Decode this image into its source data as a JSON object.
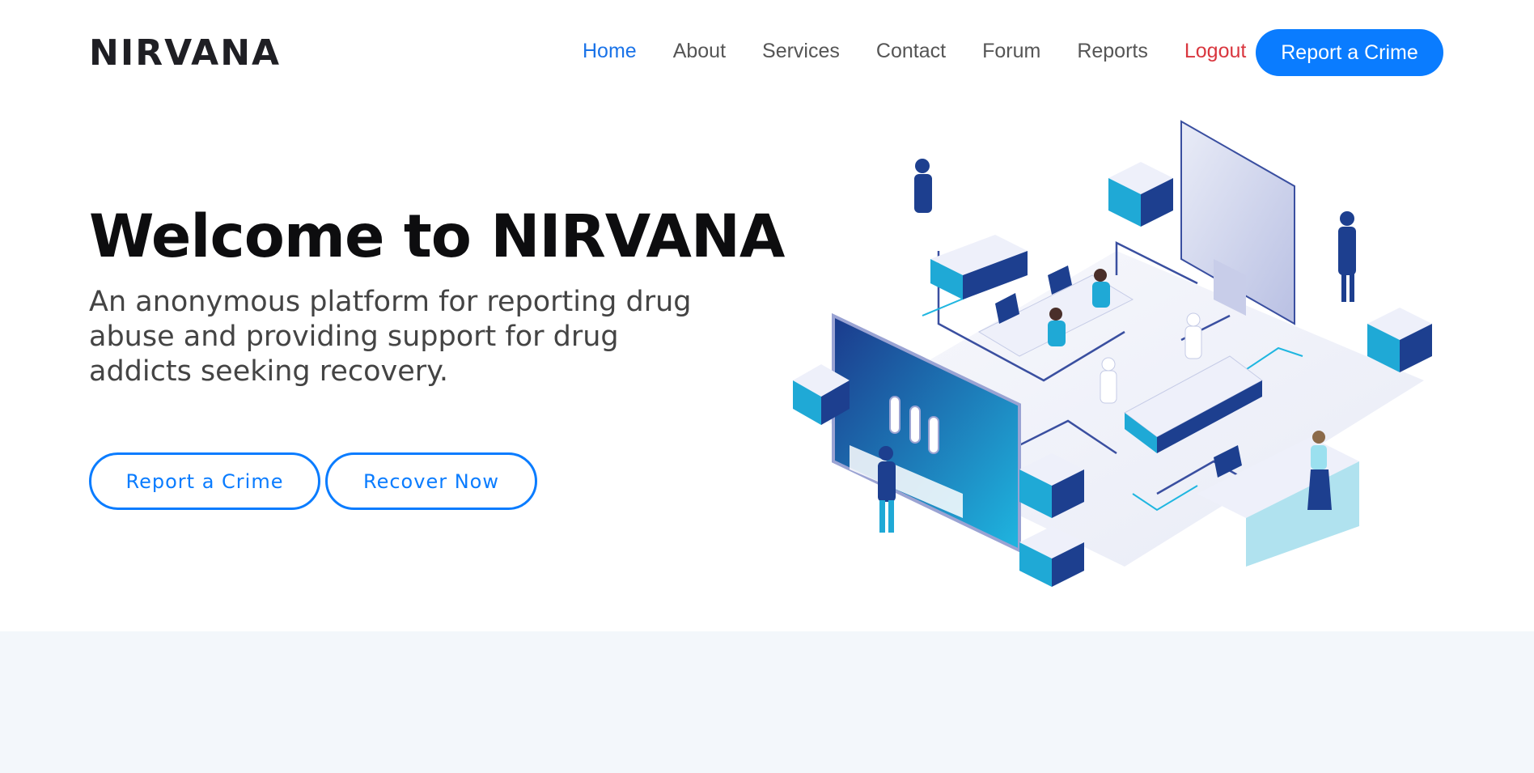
{
  "brand": {
    "name": "NIRVANA"
  },
  "nav": {
    "links": [
      {
        "label": "Home",
        "active": true
      },
      {
        "label": "About"
      },
      {
        "label": "Services"
      },
      {
        "label": "Contact"
      },
      {
        "label": "Forum"
      },
      {
        "label": "Reports"
      },
      {
        "label": "Logout"
      }
    ],
    "cta_label": "Report a Crime"
  },
  "hero": {
    "title": "Welcome to NIRVANA",
    "subtitle": "An anonymous platform for reporting drug abuse and providing support for drug addicts seeking recovery.",
    "buttons": {
      "report": "Report a Crime",
      "recover": "Recover Now"
    },
    "illustration": "isometric-lab-office-illustration"
  },
  "colors": {
    "primary": "#0a7cff",
    "active_link": "#1a73e8",
    "logout": "#d9363e",
    "lower_section_bg": "#f3f7fb"
  }
}
